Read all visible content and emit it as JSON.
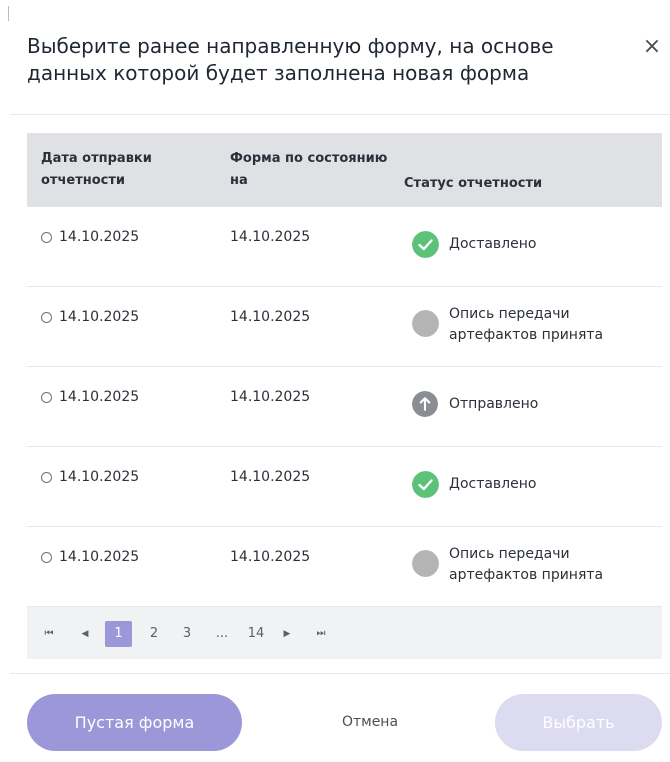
{
  "dialog": {
    "title": "Выберите ранее направленную форму, на основе данных которой будет заполнена новая форма",
    "close_glyph": "×"
  },
  "table": {
    "headers": {
      "sent_date": "Дата отправки отчетности",
      "form_date": "Форма по состоянию на",
      "status": "Статус отчетности"
    },
    "rows": [
      {
        "sent_date": "14.10.2025",
        "form_date": "14.10.2025",
        "status": "Доставлено",
        "status_icon": "check-icon"
      },
      {
        "sent_date": "14.10.2025",
        "form_date": "14.10.2025",
        "status": "Опись передачи артефактов принята",
        "status_icon": "grey-dot-icon"
      },
      {
        "sent_date": "14.10.2025",
        "form_date": "14.10.2025",
        "status": "Отправлено",
        "status_icon": "arrow-up-icon"
      },
      {
        "sent_date": "14.10.2025",
        "form_date": "14.10.2025",
        "status": "Доставлено",
        "status_icon": "check-icon"
      },
      {
        "sent_date": "14.10.2025",
        "form_date": "14.10.2025",
        "status": "Опись передачи артефактов принята",
        "status_icon": "grey-dot-icon"
      }
    ]
  },
  "pagination": {
    "first_glyph": "⏮",
    "prev_glyph": "◀",
    "pages": [
      "1",
      "2",
      "3"
    ],
    "ellipsis": "...",
    "last_page": "14",
    "next_glyph": "▶",
    "last_glyph": "⏭",
    "current_page": "1"
  },
  "footer": {
    "empty_form_label": "Пустая форма",
    "cancel_label": "Отмена",
    "choose_label": "Выбрать"
  },
  "colors": {
    "accent": "#9b97d8",
    "accent_disabled": "#dcdbf0",
    "success": "#5cc279",
    "neutral_status": "#b4b4b4",
    "sent_status": "#8a8d92",
    "header_bg": "#dfe1e4"
  }
}
